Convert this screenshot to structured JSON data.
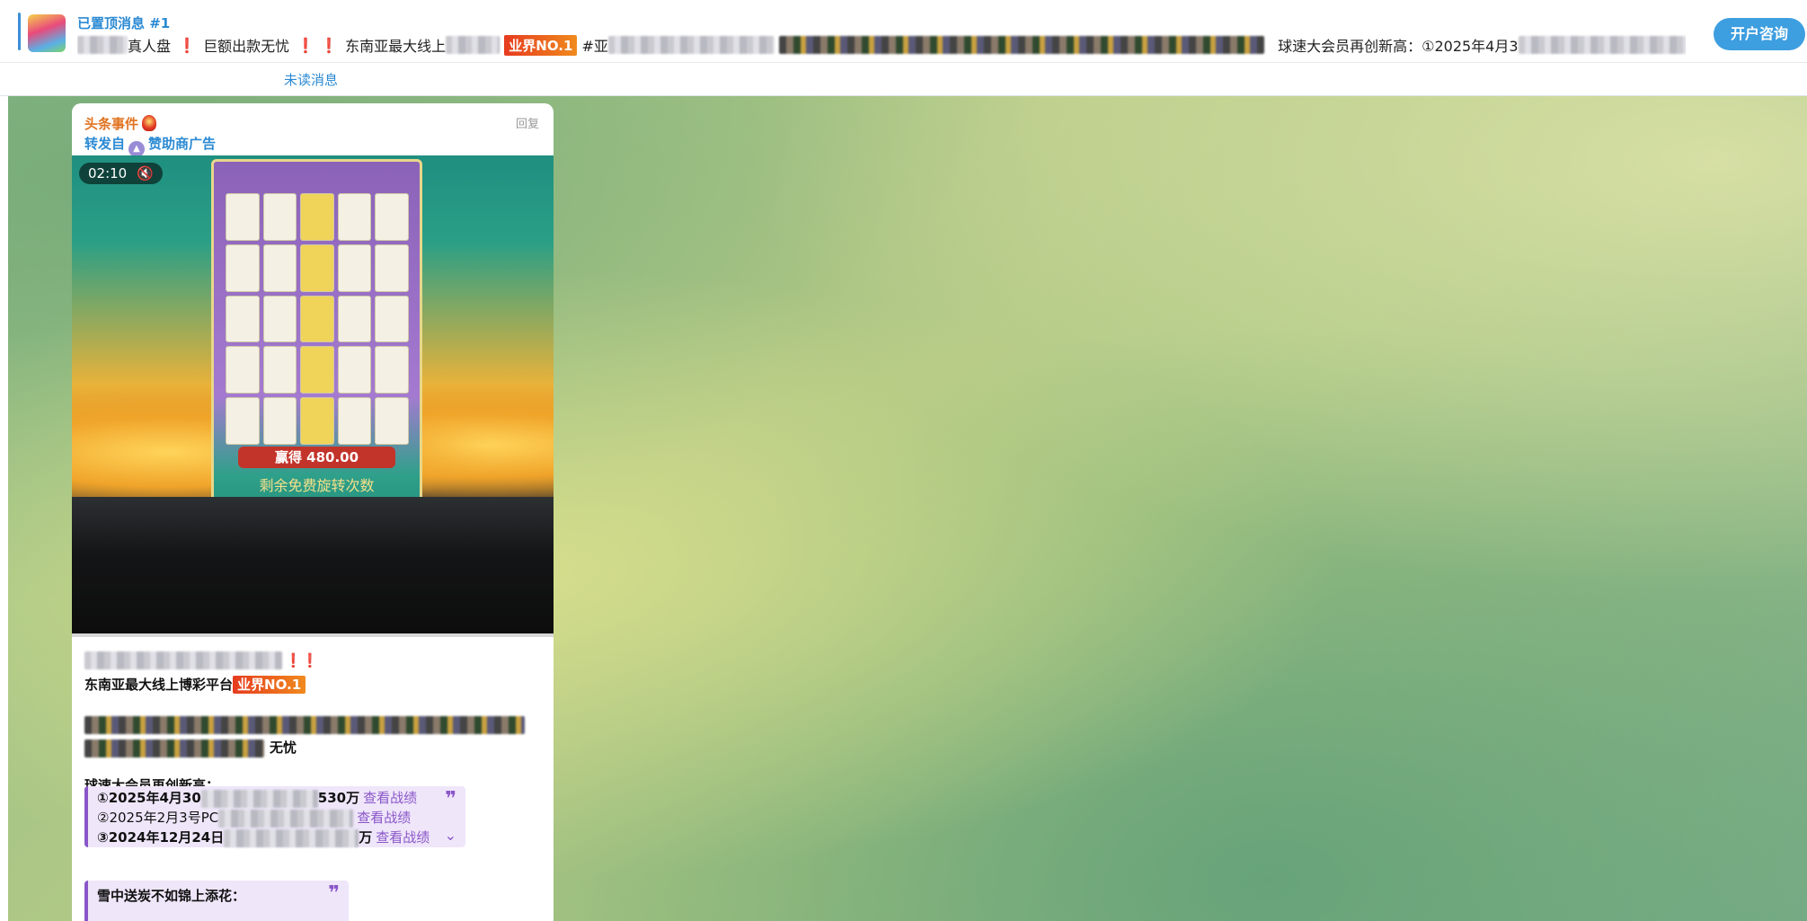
{
  "pinned": {
    "title": "已置顶消息 #1",
    "seg1": "真人盘",
    "seg2": "巨额出款无忧",
    "seg3": "东南亚最大线上",
    "badge": "业界NO.1",
    "seg4": "#亚",
    "seg5": "球速大会员再创新高：①2025年4月3"
  },
  "header_button": {
    "label": "开户咨询"
  },
  "unread": {
    "label": "未读消息"
  },
  "message": {
    "channel_name": "头条事件",
    "reply_label": "回复",
    "forward_prefix": "转发自",
    "forward_source": "赞助商广告",
    "video": {
      "duration": "02:10",
      "mute_icon": "speaker-muted-icon",
      "win_amount": "赢得 480.00",
      "free_spins_label": "剩余免费旋转次数"
    },
    "lines": {
      "platform": "东南亚最大线上博彩平台",
      "badge": "业界NO.1",
      "wuyou": "无忧",
      "members_header": "球速大会员再创新高："
    },
    "quote": {
      "row1": "①2025年4月30",
      "row1_tail": "530万",
      "row2": "②2025年2月3号PC",
      "row3": "③2024年12月24日",
      "row3_tail": "万",
      "link": "查看战绩"
    },
    "quote2": {
      "title": "雪中送炭不如锦上添花："
    }
  },
  "colors": {
    "accent": "#2b8ad3",
    "button": "#3d9ee0",
    "quote_accent": "#8a56c8",
    "badge": "#e63b1f"
  }
}
